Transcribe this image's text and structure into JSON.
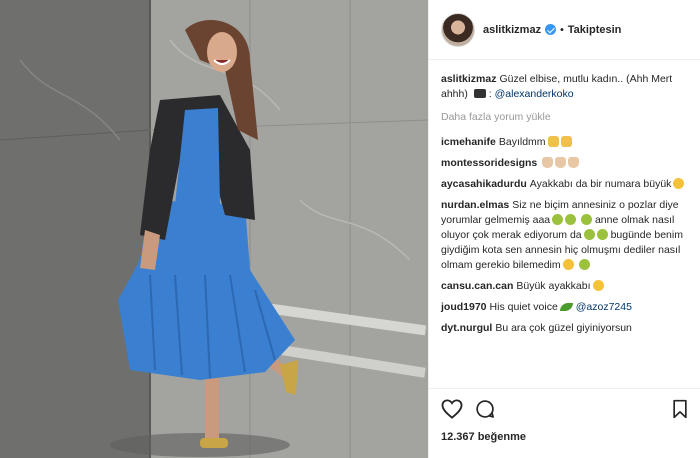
{
  "post": {
    "username": "aslitkizmaz",
    "follow_status": "Takiptesin"
  },
  "caption": {
    "username": "aslitkizmaz",
    "text": "Güzel elbise, mutlu kadın.. (Ahh Mert ahhh)",
    "mention": "@alexanderkoko"
  },
  "load_more_label": "Daha fazla yorum yükle",
  "comments": [
    {
      "username": "icmehanife",
      "text": "Bayıldmm"
    },
    {
      "username": "montessoridesigns",
      "text": ""
    },
    {
      "username": "aycasahikadurdu",
      "text": "Ayakkabı da bir numara büyük"
    },
    {
      "username": "nurdan.elmas",
      "text_1": "Siz ne biçim annesiniz o pozlar diye yorumlar gelmemiş aaa",
      "text_2": "anne olmak nasıl oluyor çok merak ediyorum da",
      "text_3": "bugünde benim giydiğim kota sen annesin hiç olmuşmı dediler nasıl olmam gerekio bilemedim"
    },
    {
      "username": "cansu.can.can",
      "text": "Büyük ayakkabı"
    },
    {
      "username": "joud1970",
      "text": "His quiet voice",
      "mention": "@azoz7245"
    },
    {
      "username": "dyt.nurgul",
      "text": "Bu ara çok güzel giyiniyorsun"
    }
  ],
  "likes": {
    "count_text": "12.367 beğenme"
  },
  "icons": [
    "heart-icon",
    "comment-icon",
    "bookmark-icon",
    "verified-badge-icon",
    "camera-emoji",
    "leaf-emoji"
  ],
  "colors": {
    "verified_blue": "#3897f0",
    "mention_blue": "#003569",
    "muted_gray": "#999999",
    "dress_blue": "#3a7fd0"
  }
}
